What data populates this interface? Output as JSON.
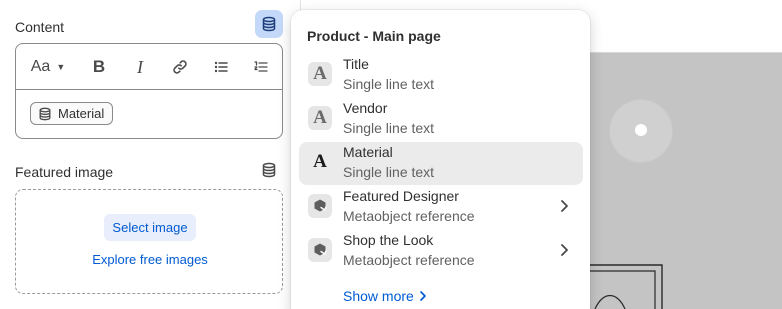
{
  "content_field": {
    "label": "Content",
    "toolbar": {
      "font_label": "Aa",
      "bold_label": "B",
      "italic_label": "I"
    },
    "dynamic_pill_label": "Material"
  },
  "featured_image": {
    "label": "Featured image",
    "select_label": "Select image",
    "explore_label": "Explore free images"
  },
  "dropdown": {
    "title": "Product - Main page",
    "items": [
      {
        "name": "Title",
        "type": "Single line text",
        "icon": "text-icon",
        "glyph": "A",
        "selected": false,
        "has_submenu": false
      },
      {
        "name": "Vendor",
        "type": "Single line text",
        "icon": "text-icon",
        "glyph": "A",
        "selected": false,
        "has_submenu": false
      },
      {
        "name": "Material",
        "type": "Single line text",
        "icon": "text-icon",
        "glyph": "A",
        "selected": true,
        "has_submenu": false
      },
      {
        "name": "Featured Designer",
        "type": "Metaobject reference",
        "icon": "metaobject-icon",
        "glyph": "",
        "selected": false,
        "has_submenu": true
      },
      {
        "name": "Shop the Look",
        "type": "Metaobject reference",
        "icon": "metaobject-icon",
        "glyph": "",
        "selected": false,
        "has_submenu": true
      }
    ],
    "show_more_label": "Show more"
  },
  "colors": {
    "link": "#005bd3",
    "active_dynamic_button": "#c4d8f9",
    "selected_item": "#ebebeb"
  }
}
